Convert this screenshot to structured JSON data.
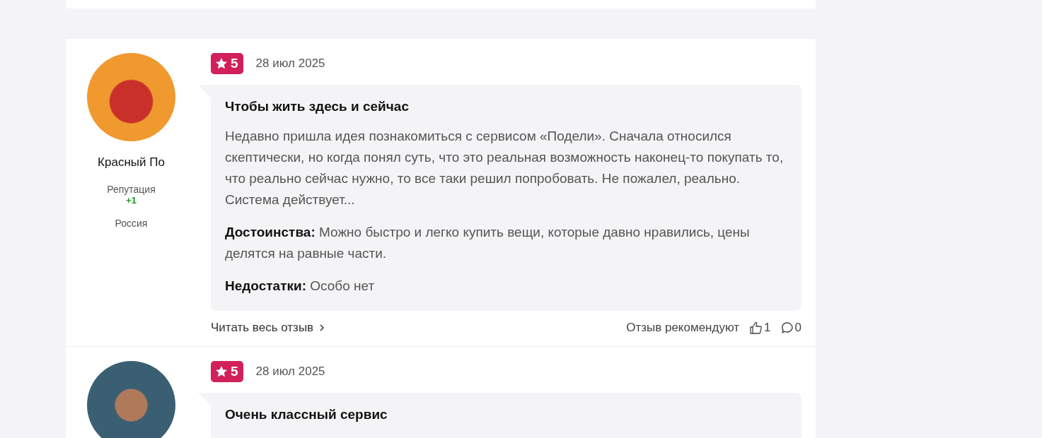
{
  "reviews": [
    {
      "author": "Красный По",
      "reputation_label": "Репутация",
      "reputation": "+1",
      "country": "Россия",
      "rating": "5",
      "date": "28 июл 2025",
      "title": "Чтобы жить здесь и сейчас",
      "text": "Недавно пришла идея познакомиться с сервисом «Подели». Сначала относился скептически, но когда понял суть, что это реальная возможность наконец-то покупать то, что реально сейчас нужно, то все таки решил попробовать. Не пожалел, реально. Система действует...",
      "pros_label": "Достоинства:",
      "pros": "Можно быстро и легко купить вещи, которые давно нравились, цены делятся на равные части.",
      "cons_label": "Недостатки:",
      "cons": "Особо нет",
      "read_more": "Читать весь отзыв",
      "recommend_label": "Отзыв рекомендуют",
      "likes": "1",
      "comments": "0"
    },
    {
      "rating": "5",
      "date": "28 июл 2025",
      "title": "Очень классный сервис"
    }
  ]
}
